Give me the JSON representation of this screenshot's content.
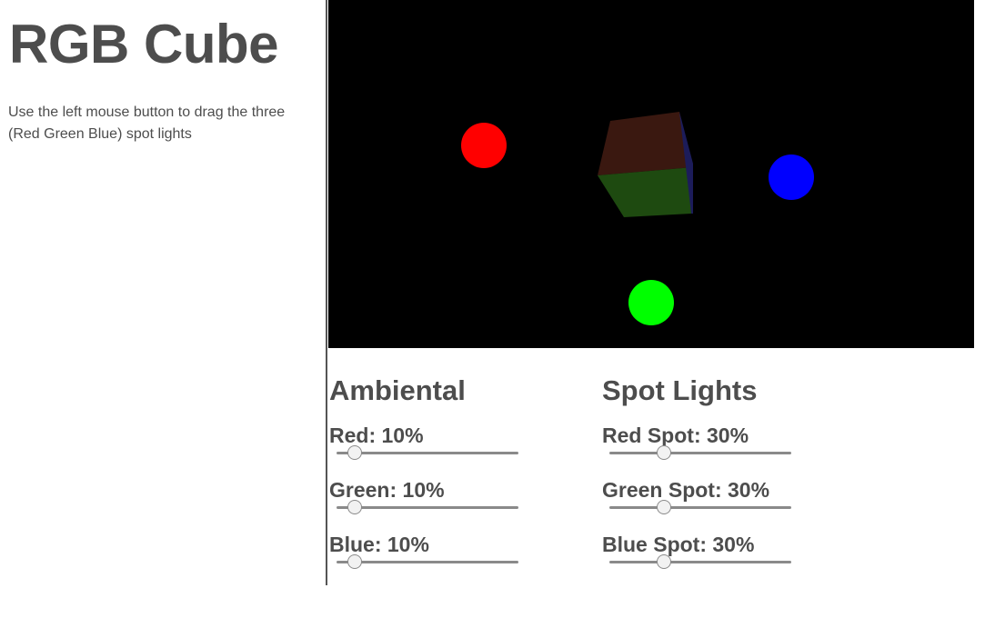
{
  "page": {
    "title": "RGB Cube",
    "instructions": "Use the left mouse button to drag the three (Red Green Blue) spot lights"
  },
  "scene": {
    "lights": [
      {
        "name": "Red",
        "color": "#ff0000"
      },
      {
        "name": "Green",
        "color": "#00ff00"
      },
      {
        "name": "Blue",
        "color": "#0000ff"
      }
    ],
    "cube": {
      "top_face": "#3a1810",
      "front_face": "#1e4a10",
      "side_face": "#1c1c5a"
    }
  },
  "ambient": {
    "heading": "Ambiental",
    "controls": [
      {
        "label": "Red: ",
        "value": 10,
        "unit": "%"
      },
      {
        "label": "Green: ",
        "value": 10,
        "unit": "%"
      },
      {
        "label": "Blue: ",
        "value": 10,
        "unit": "%"
      }
    ]
  },
  "spot": {
    "heading": "Spot Lights",
    "controls": [
      {
        "label": "Red Spot: ",
        "value": 30,
        "unit": "%"
      },
      {
        "label": "Green Spot: ",
        "value": 30,
        "unit": "%"
      },
      {
        "label": "Blue Spot: ",
        "value": 30,
        "unit": "%"
      }
    ]
  }
}
